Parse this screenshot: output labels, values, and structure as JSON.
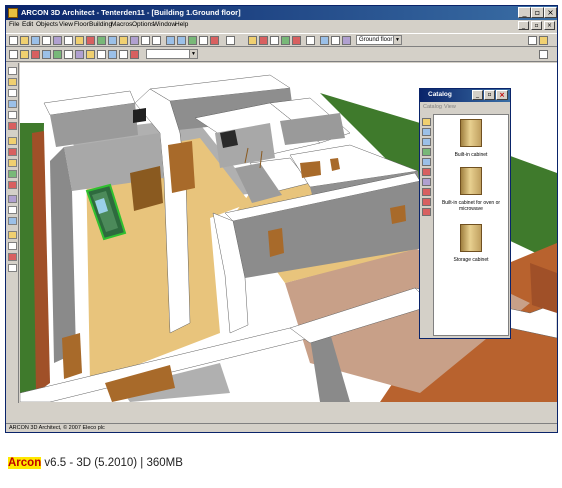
{
  "window": {
    "title": "ARCON 3D Architect  -  Tenterden11 - [Building 1.Ground floor]",
    "controls": [
      "_",
      "▫",
      "×"
    ]
  },
  "menu": [
    "File",
    "Edit",
    "Objects",
    "View",
    "Floor",
    "Building",
    "Macros",
    "Options",
    "Window",
    "Help"
  ],
  "toolbar": {
    "floor_select": "Ground floor"
  },
  "catalog": {
    "title": "Catalog",
    "menu": [
      "Catalog",
      "View"
    ],
    "items": [
      {
        "label": "Built-in cabinet"
      },
      {
        "label": "Built-in cabinet for oven or microwave"
      },
      {
        "label": "Storage cabinet"
      }
    ]
  },
  "status_bar": {
    "text": "ARCON 3D Architect, © 2007 Eleco plc"
  },
  "caption": {
    "brand": "Arcon",
    "rest": " v6.5 - 3D (5.2010) | 360MB"
  },
  "colors": {
    "title_bar": "#0a246a",
    "window_face": "#d4d0c8",
    "wall_top": "#ffffff",
    "wall_side": "#9a9a9a",
    "floor_wood": "#e8c47c",
    "floor_tile": "#c8a088",
    "brick": "#b8622e",
    "grass": "#3f7a2c",
    "caption_highlight": "#ffe800",
    "caption_brand": "#c00000"
  }
}
